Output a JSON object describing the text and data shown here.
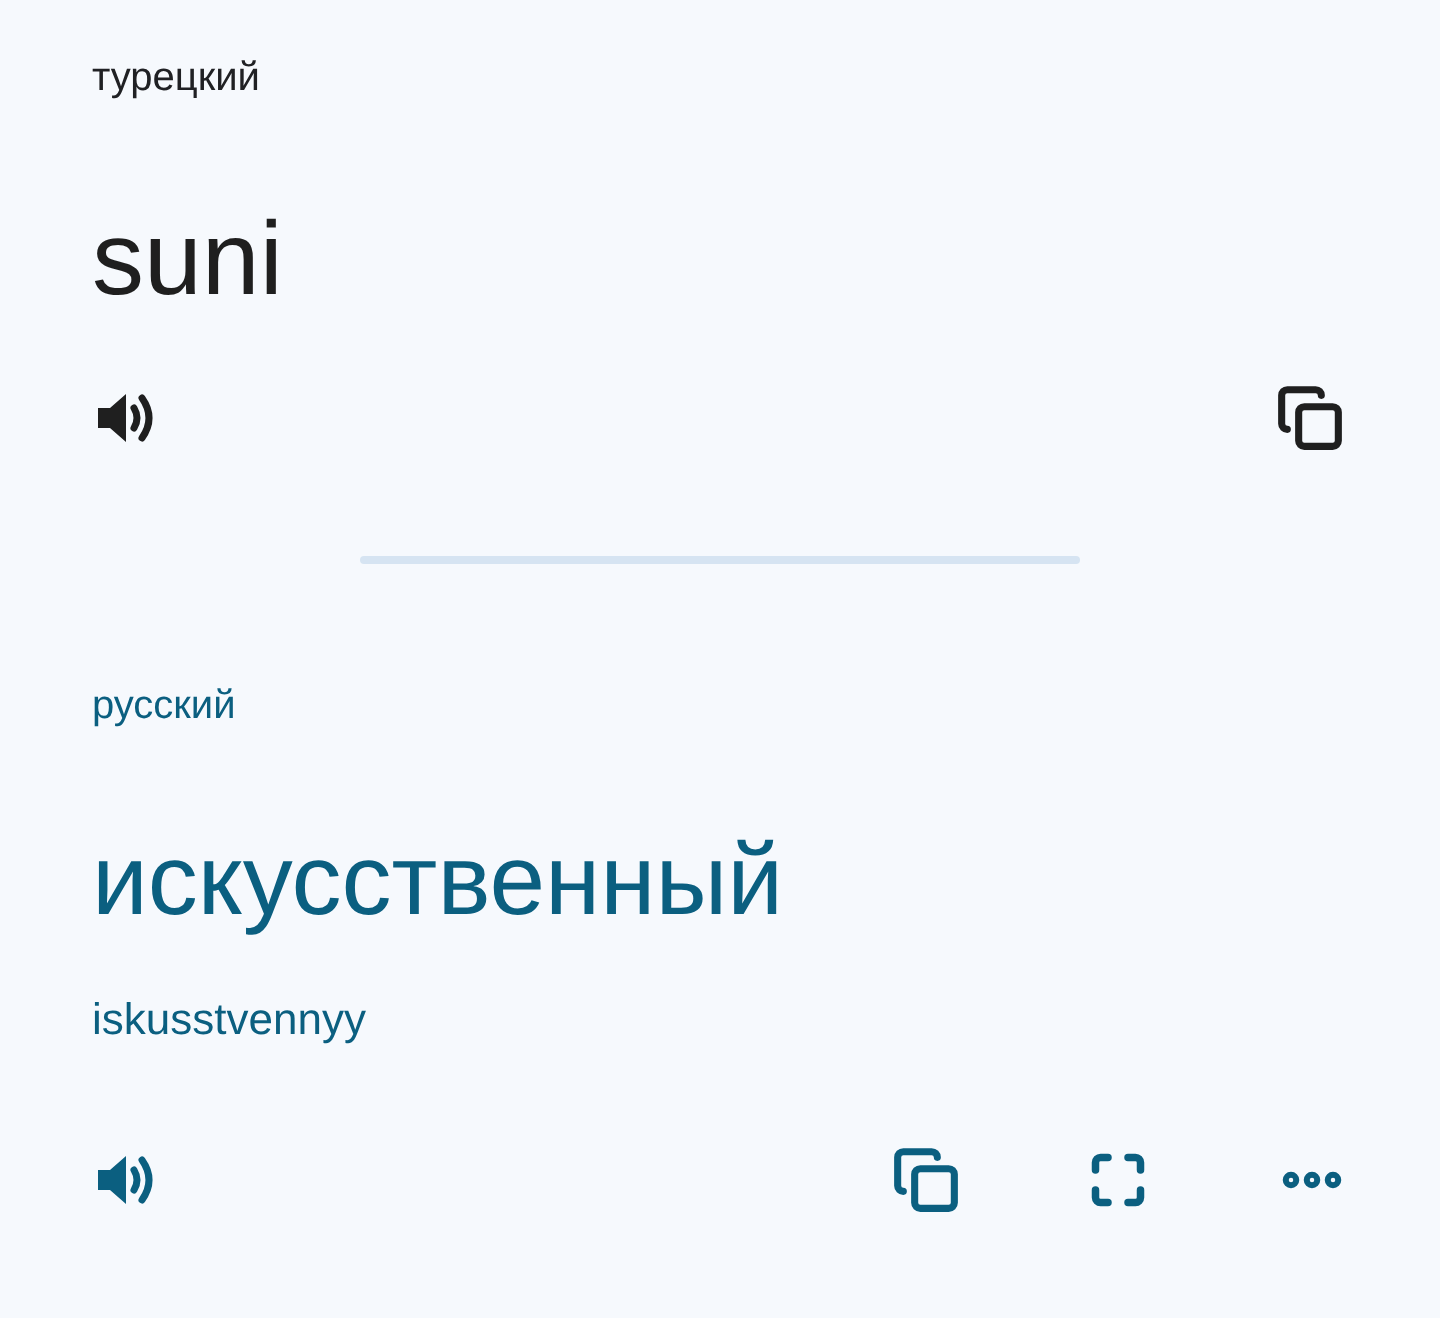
{
  "source": {
    "language": "турецкий",
    "text": "suni"
  },
  "target": {
    "language": "русский",
    "text": "искусственный",
    "transliteration": "iskusstvennyy"
  }
}
